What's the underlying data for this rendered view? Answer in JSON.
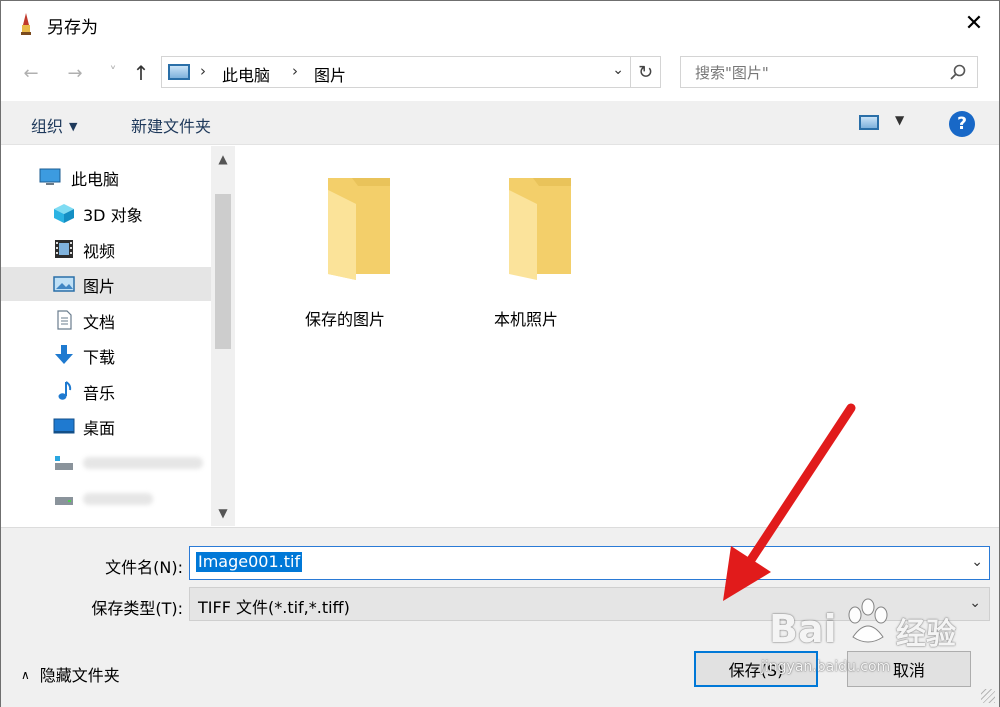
{
  "window": {
    "title": "另存为",
    "close_glyph": "✕"
  },
  "nav": {
    "back_glyph": "←",
    "forward_glyph": "→",
    "recent_glyph": "˅",
    "up_glyph": "↑",
    "breadcrumb": [
      "此电脑",
      "图片"
    ],
    "breadcrumb_sep": "›",
    "dropdown_glyph": "⌄",
    "refresh_glyph": "↻",
    "search_placeholder": "搜索\"图片\""
  },
  "toolbar": {
    "organize_label": "组织",
    "organize_arrow": "▼",
    "new_folder_label": "新建文件夹",
    "view_caret": "▼",
    "help_glyph": "?"
  },
  "sidebar": {
    "items": [
      {
        "label": "此电脑",
        "icon": "computer-icon"
      },
      {
        "label": "3D 对象",
        "icon": "3d-objects-icon"
      },
      {
        "label": "视频",
        "icon": "video-icon"
      },
      {
        "label": "图片",
        "icon": "pictures-icon",
        "selected": true
      },
      {
        "label": "文档",
        "icon": "documents-icon"
      },
      {
        "label": "下载",
        "icon": "download-icon"
      },
      {
        "label": "音乐",
        "icon": "music-icon"
      },
      {
        "label": "桌面",
        "icon": "desktop-icon"
      }
    ],
    "scroll_up_glyph": "▲",
    "scroll_down_glyph": "▼"
  },
  "files": [
    {
      "name": "保存的图片",
      "icon": "folder-icon"
    },
    {
      "name": "本机照片",
      "icon": "folder-icon"
    }
  ],
  "form": {
    "filename_label": "文件名(N):",
    "filename_value": "Image001.tif",
    "filetype_label": "保存类型(T):",
    "filetype_value": "TIFF 文件(*.tif,*.tiff)",
    "dropdown_glyph": "⌄"
  },
  "footer": {
    "hide_folders_caret": "∧",
    "hide_folders_label": "隐藏文件夹",
    "save_label": "保存(S)",
    "cancel_label": "取消"
  },
  "watermark": {
    "brand": "Bai",
    "brand_cn": "经验",
    "url": "jingyan.baidu.com"
  },
  "colors": {
    "accent": "#0078d7",
    "annotation_arrow": "#e11b1b",
    "folder": "#f7d675"
  }
}
